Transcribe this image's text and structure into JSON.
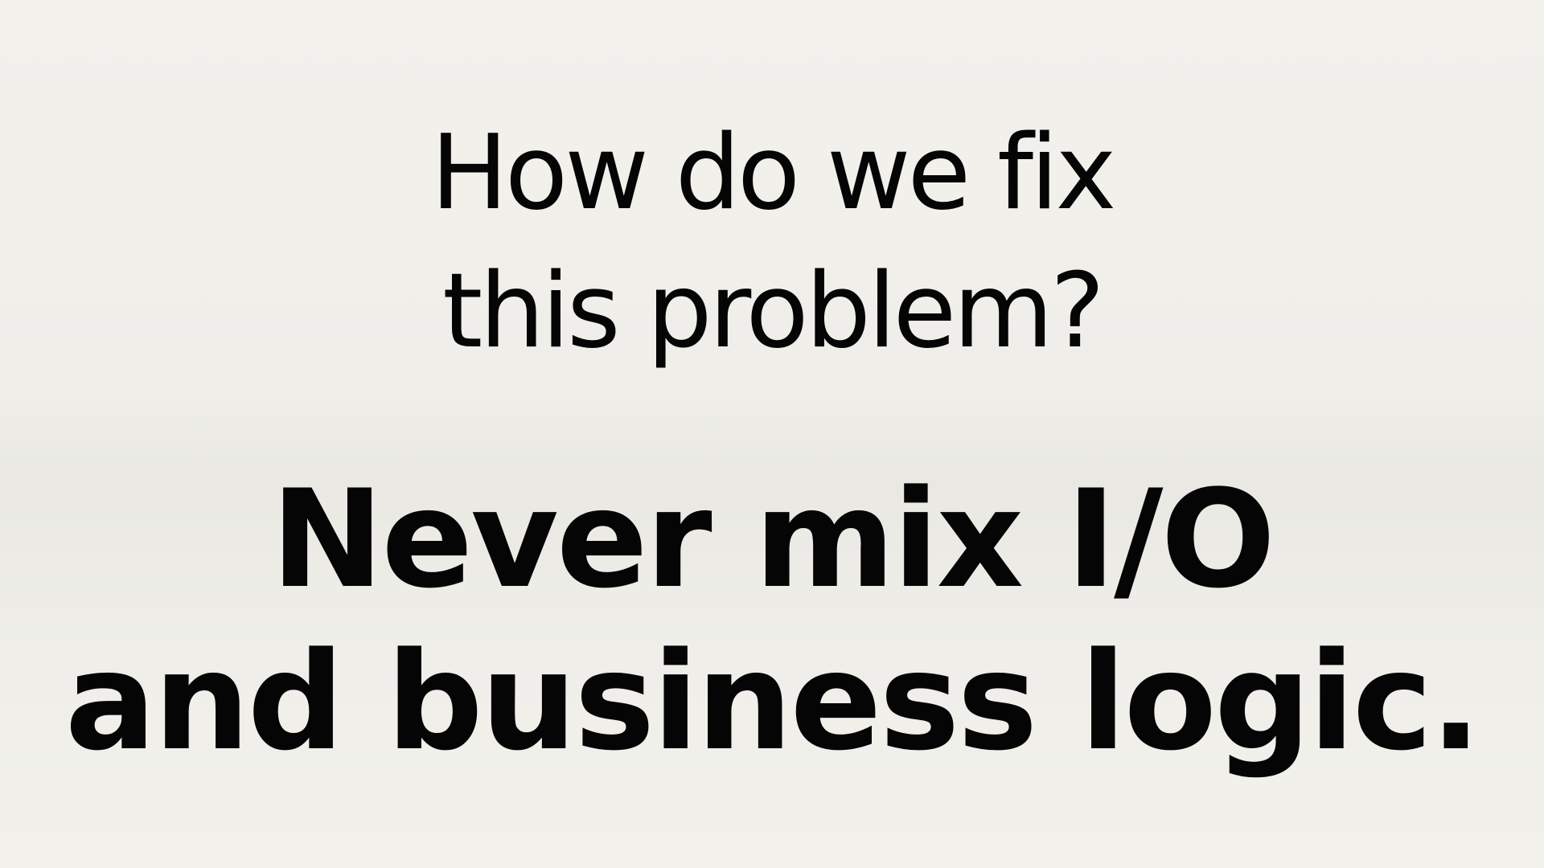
{
  "slide": {
    "question": {
      "line1": "How do we fix",
      "line2": "this problem?"
    },
    "answer": {
      "line1": "Never mix I/O",
      "line2": "and business logic."
    }
  },
  "colors": {
    "background": "#efeee9",
    "text": "#050505"
  }
}
